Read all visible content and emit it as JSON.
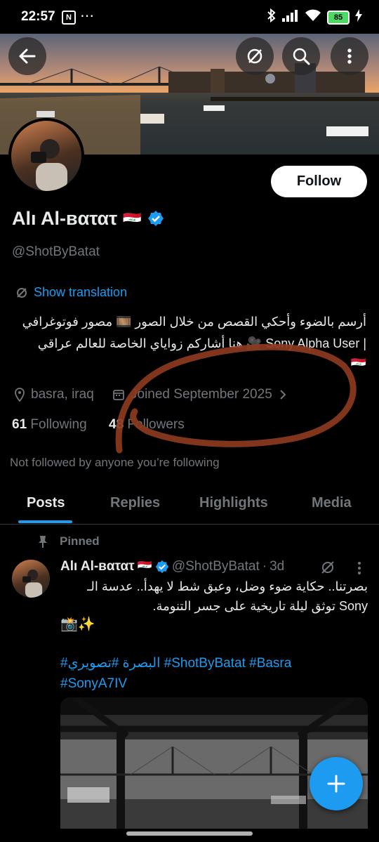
{
  "status_bar": {
    "time": "22:57",
    "nfc": "N",
    "more": "⋯",
    "battery": "85"
  },
  "profile": {
    "name": "Alı Al-вατατ",
    "flag": "🇮🇶",
    "handle": "@ShotByBatat",
    "follow_label": "Follow",
    "show_translation": "Show translation",
    "bio_line1": "أرسم بالضوء وأحكي القصص من خلال الصور 🎞️ مصور فوتوغرافي",
    "bio_line2": "| Sony Alpha User 🎥 هنا أشاركم زواياي الخاصة للعالم  عراقي",
    "bio_line3": "🇮🇶",
    "location": "basra, iraq",
    "joined": "Joined September 2025",
    "following_count": "61",
    "following_label": "Following",
    "followers_count": "48",
    "followers_label": "Followers",
    "not_followed": "Not followed by anyone you’re following"
  },
  "tabs": [
    {
      "label": "Posts",
      "active": true
    },
    {
      "label": "Replies",
      "active": false
    },
    {
      "label": "Highlights",
      "active": false
    },
    {
      "label": "Media",
      "active": false
    }
  ],
  "post": {
    "pinned_label": "Pinned",
    "author": "Alı Al-вατατ",
    "flag": "🇮🇶",
    "handle": "@ShotByBatat",
    "dot": "·",
    "time": "3d",
    "line1": "بصرتنا.. حكاية ضوء وضل، وعبق شط لا يهدأ.. عدسة الـ",
    "line2": "Sony توثق ليلة تاريخية على جسر التنومة.",
    "line3": "📸✨",
    "hashtags_line1": "#البصرة #تصويري #ShotByBatat #Basra",
    "hashtags_line2": "#SonyA7IV"
  },
  "colors": {
    "accent": "#1d9bf0",
    "background": "#000000",
    "muted": "#71767b",
    "text": "#e7e9ea",
    "annotation": "#8b3a1e"
  }
}
